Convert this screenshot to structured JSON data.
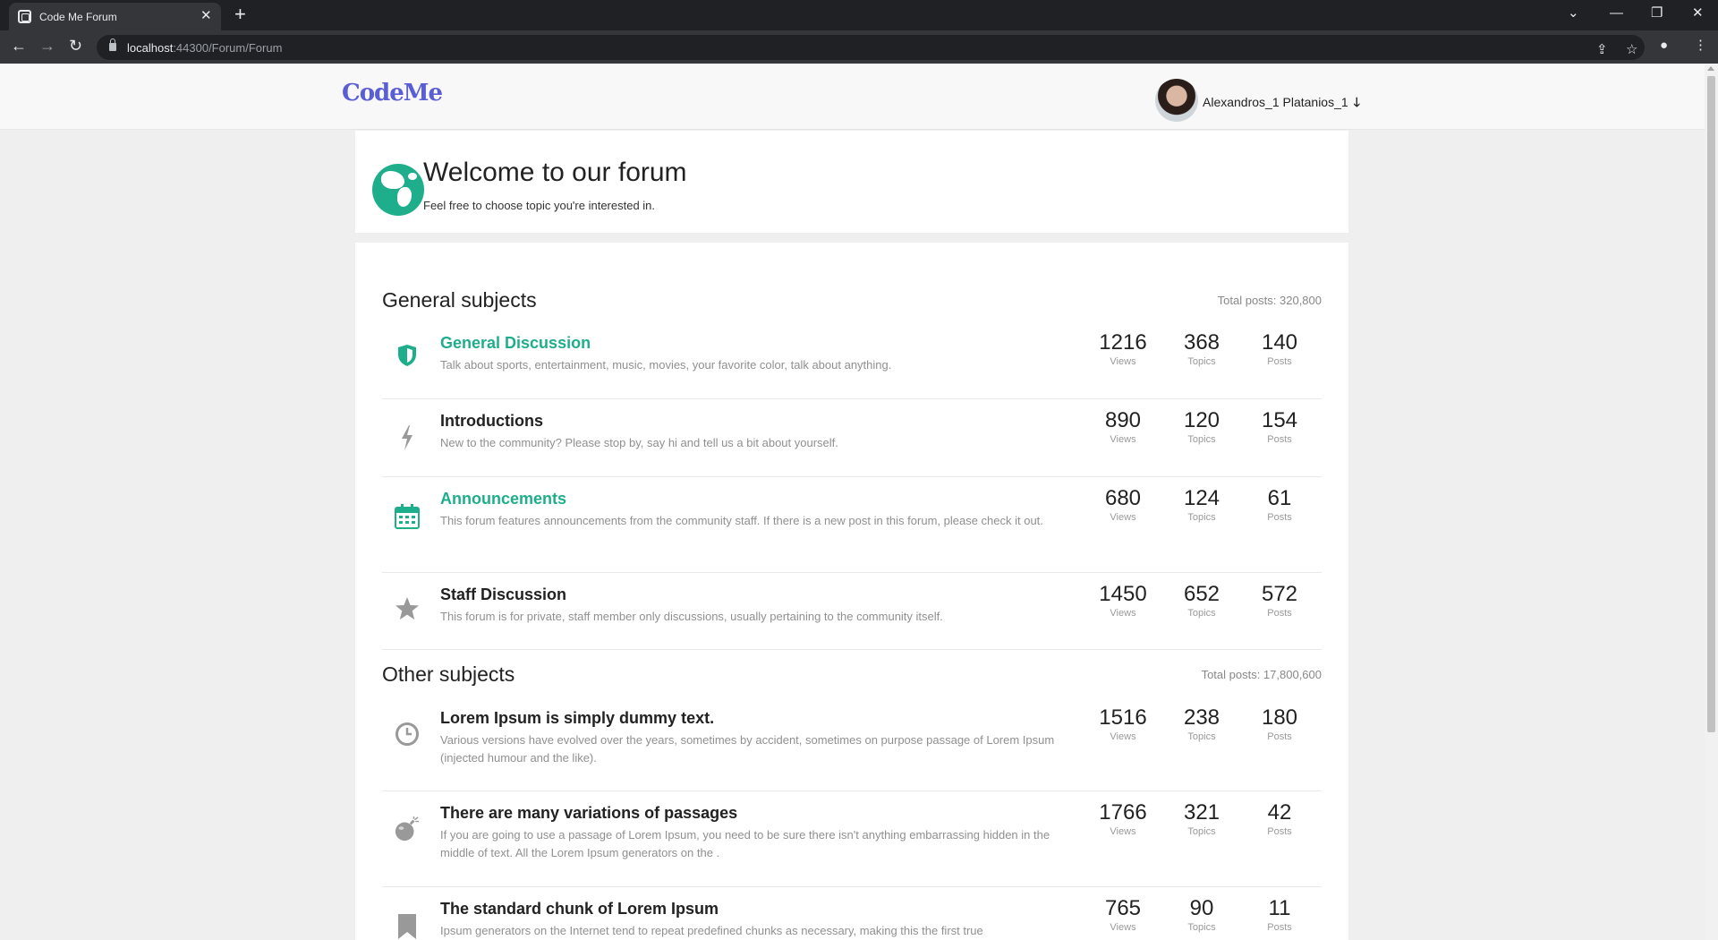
{
  "browser": {
    "tab_title": "Code Me Forum",
    "tab_close": "✕",
    "new_tab": "+",
    "url_host": "localhost",
    "url_path": ":44300/Forum/Forum"
  },
  "header": {
    "brand": "CodeMe",
    "user_name": "Alexandros_1 Platanios_1",
    "user_menu_icon": "arrow-down-icon"
  },
  "welcome": {
    "title": "Welcome to our forum",
    "subtitle": "Feel free to choose topic you're interested in.",
    "icon": "globe-icon"
  },
  "stat_labels": {
    "views": "Views",
    "topics": "Topics",
    "posts": "Posts"
  },
  "sections": [
    {
      "title": "General subjects",
      "total": "Total posts: 320,800",
      "forums": [
        {
          "title": "General Discussion",
          "description": "Talk about sports, entertainment, music, movies, your favorite color, talk about anything.",
          "views": "1216",
          "topics": "368",
          "posts": "140",
          "icon": "shield-icon",
          "accent": "#1fae8c"
        },
        {
          "title": "Introductions",
          "description": "New to the community? Please stop by, say hi and tell us a bit about yourself.",
          "views": "890",
          "topics": "120",
          "posts": "154",
          "icon": "bolt-icon",
          "accent": "#222222"
        },
        {
          "title": "Announcements",
          "description": "This forum features announcements from the community staff. If there is a new post in this forum, please check it out.",
          "views": "680",
          "topics": "124",
          "posts": "61",
          "icon": "calendar-icon",
          "accent": "#1fae8c"
        },
        {
          "title": "Staff Discussion",
          "description": "This forum is for private, staff member only discussions, usually pertaining to the community itself.",
          "views": "1450",
          "topics": "652",
          "posts": "572",
          "icon": "star-icon",
          "accent": "#222222"
        }
      ]
    },
    {
      "title": "Other subjects",
      "total": "Total posts: 17,800,600",
      "forums": [
        {
          "title": "Lorem Ipsum is simply dummy text.",
          "description": "Various versions have evolved over the years, sometimes by accident, sometimes on purpose passage of Lorem Ipsum (injected humour and the like).",
          "views": "1516",
          "topics": "238",
          "posts": "180",
          "icon": "clock-icon",
          "accent": "#222222"
        },
        {
          "title": "There are many variations of passages",
          "description": "If you are going to use a passage of Lorem Ipsum, you need to be sure there isn't anything embarrassing hidden in the middle of text. All the Lorem Ipsum generators on the .",
          "views": "1766",
          "topics": "321",
          "posts": "42",
          "icon": "bomb-icon",
          "accent": "#222222"
        },
        {
          "title": "The standard chunk of Lorem Ipsum",
          "description": "Ipsum generators on the Internet tend to repeat predefined chunks as necessary, making this the first true",
          "views": "765",
          "topics": "90",
          "posts": "11",
          "icon": "bookmark-icon",
          "accent": "#222222"
        }
      ]
    }
  ]
}
